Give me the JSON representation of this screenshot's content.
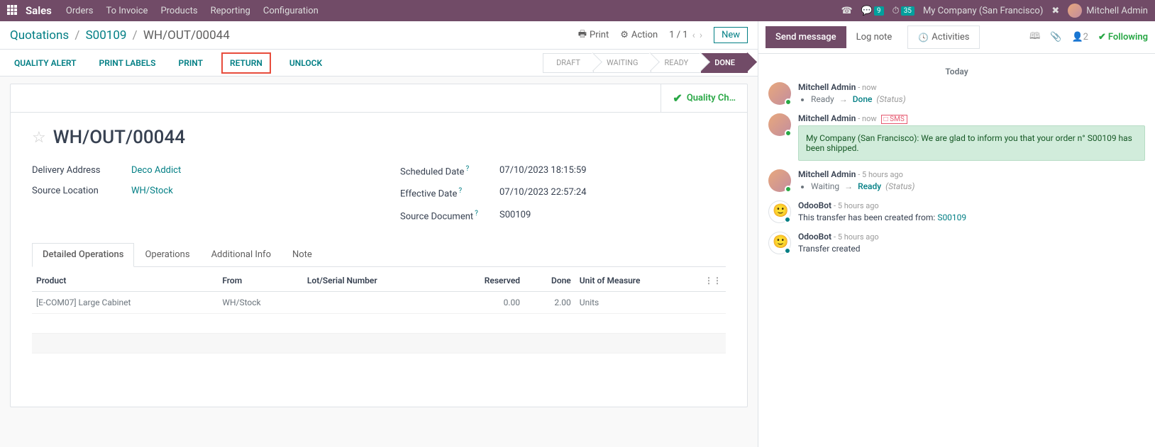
{
  "topbar": {
    "brand": "Sales",
    "menu": [
      "Orders",
      "To Invoice",
      "Products",
      "Reporting",
      "Configuration"
    ],
    "chat_badge": "9",
    "clock_badge": "35",
    "company": "My Company (San Francisco)",
    "user": "Mitchell Admin"
  },
  "breadcrumb": {
    "root": "Quotations",
    "parent": "S00109",
    "current": "WH/OUT/00044"
  },
  "cp": {
    "print": "Print",
    "action": "Action",
    "pager": "1 / 1",
    "new": "New"
  },
  "actions": {
    "quality_alert": "QUALITY ALERT",
    "print_labels": "PRINT LABELS",
    "print": "PRINT",
    "return": "RETURN",
    "unlock": "UNLOCK"
  },
  "statuses": [
    "DRAFT",
    "WAITING",
    "READY",
    "DONE"
  ],
  "statbtn": {
    "quality": "Quality Ch…"
  },
  "form": {
    "title": "WH/OUT/00044",
    "delivery_address_label": "Delivery Address",
    "delivery_address": "Deco Addict",
    "source_location_label": "Source Location",
    "source_location": "WH/Stock",
    "scheduled_date_label": "Scheduled Date",
    "scheduled_date": "07/10/2023 18:15:59",
    "effective_date_label": "Effective Date",
    "effective_date": "07/10/2023 22:57:24",
    "source_document_label": "Source Document",
    "source_document": "S00109"
  },
  "tabs": [
    "Detailed Operations",
    "Operations",
    "Additional Info",
    "Note"
  ],
  "table": {
    "headers": {
      "product": "Product",
      "from": "From",
      "lot": "Lot/Serial Number",
      "reserved": "Reserved",
      "done": "Done",
      "uom": "Unit of Measure"
    },
    "rows": [
      {
        "product": "[E-COM07] Large Cabinet",
        "from": "WH/Stock",
        "lot": "",
        "reserved": "0.00",
        "done": "2.00",
        "uom": "Units"
      }
    ]
  },
  "chatter": {
    "send": "Send message",
    "log": "Log note",
    "activities": "Activities",
    "followers": "2",
    "following": "Following",
    "today": "Today",
    "messages": [
      {
        "author": "Mitchell Admin",
        "time": "now",
        "type": "track",
        "track": {
          "old": "Ready",
          "new": "Done",
          "field": "(Status)"
        }
      },
      {
        "author": "Mitchell Admin",
        "time": "now",
        "sms": "SMS",
        "type": "note",
        "body": "My Company (San Francisco): We are glad to inform you that your order n° S00109 has been shipped."
      },
      {
        "author": "Mitchell Admin",
        "time": "5 hours ago",
        "type": "track",
        "track": {
          "old": "Waiting",
          "new": "Ready",
          "field": "(Status)"
        }
      },
      {
        "author": "OdooBot",
        "time": "5 hours ago",
        "type": "body",
        "bot": true,
        "body_prefix": "This transfer has been created from: ",
        "body_link": "S00109"
      },
      {
        "author": "OdooBot",
        "time": "5 hours ago",
        "type": "body",
        "bot": true,
        "body_prefix": "Transfer created",
        "body_link": ""
      }
    ]
  }
}
